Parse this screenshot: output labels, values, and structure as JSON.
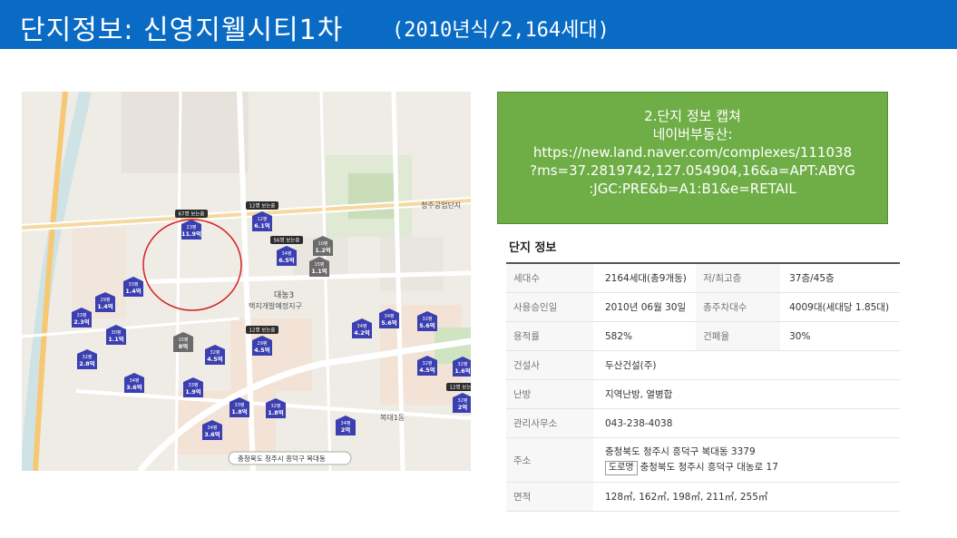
{
  "header": {
    "title_main": "단지정보: 신영지웰시티1차",
    "title_sub": "(2010년식/2,164세대)"
  },
  "colors": {
    "header_bg": "#0a6bc4",
    "capture_bg": "#6fae47",
    "marker_blue": "#3b3fb0",
    "marker_gray": "#6b6b6b",
    "highlight_circle": "#d81f26"
  },
  "capture_note": {
    "lines": [
      "2.단지 정보 캡쳐",
      "네이버부동산:",
      "https://new.land.naver.com/complexes/111038",
      "?ms=37.2819742,127.054904,16&a=APT:ABYG",
      ":JGC:PRE&b=A1:B1&e=RETAIL"
    ]
  },
  "info": {
    "heading": "단지 정보",
    "rows": [
      {
        "label": "세대수",
        "value": "2164세대(총9개동)",
        "label2": "저/최고층",
        "value2": "37층/45층"
      },
      {
        "label": "사용승인일",
        "value": "2010년 06월 30일",
        "label2": "총주차대수",
        "value2": "4009대(세대당 1.85대)"
      },
      {
        "label": "용적률",
        "value": "582%",
        "label2": "건폐율",
        "value2": "30%"
      },
      {
        "label": "건설사",
        "value": "두산건설(주)"
      },
      {
        "label": "난방",
        "value": "지역난방, 열병합"
      },
      {
        "label": "관리사무소",
        "value": "043-238-4038"
      },
      {
        "label": "주소",
        "value": "충청북도 청주시 흥덕구 복대동 3379",
        "road_tag": "도로명",
        "road_value": "충청북도 청주시 흥덕구 대농로 17"
      },
      {
        "label": "면적",
        "value": "128㎡, 162㎡, 198㎡, 211㎡, 255㎡"
      }
    ]
  },
  "map": {
    "markers": [
      {
        "top": "23평",
        "price": "11.9억",
        "kind": "blue",
        "tag": "67명 보는중"
      },
      {
        "top": "12평",
        "price": "6.1억",
        "kind": "blue",
        "tag": "12명 보는중"
      },
      {
        "top": "34평",
        "price": "6.5억",
        "kind": "blue",
        "tag": "56명 보는중"
      },
      {
        "top": "10평",
        "price": "1.2억",
        "kind": "gray"
      },
      {
        "top": "15평",
        "price": "1.1억",
        "kind": "gray"
      },
      {
        "top": "33평",
        "price": "1.4억",
        "kind": "blue"
      },
      {
        "top": "29평",
        "price": "1.4억",
        "kind": "blue"
      },
      {
        "top": "33평",
        "price": "2.3억",
        "kind": "blue"
      },
      {
        "top": "30평",
        "price": "1.1억",
        "kind": "blue"
      },
      {
        "top": "32평",
        "price": "2.8억",
        "kind": "blue"
      },
      {
        "top": "15평",
        "price": "8억",
        "kind": "gray"
      },
      {
        "top": "32평",
        "price": "4.5억",
        "kind": "blue"
      },
      {
        "top": "29평",
        "price": "4.5억",
        "kind": "blue",
        "tag": "12명 보는중"
      },
      {
        "top": "34평",
        "price": "3.6억",
        "kind": "blue"
      },
      {
        "top": "33평",
        "price": "1.9억",
        "kind": "blue"
      },
      {
        "top": "33평",
        "price": "1.8억",
        "kind": "blue"
      },
      {
        "top": "32평",
        "price": "1.8억",
        "kind": "blue"
      },
      {
        "top": "34평",
        "price": "3.6억",
        "kind": "blue"
      },
      {
        "top": "34평",
        "price": "2억",
        "kind": "blue"
      },
      {
        "top": "34평",
        "price": "4.2억",
        "kind": "blue"
      },
      {
        "top": "34평",
        "price": "5.6억",
        "kind": "blue"
      },
      {
        "top": "32평",
        "price": "5.6억",
        "kind": "blue"
      },
      {
        "top": "32평",
        "price": "4.5억",
        "kind": "blue"
      },
      {
        "top": "32평",
        "price": "1.6억",
        "kind": "blue"
      },
      {
        "top": "32평",
        "price": "2억",
        "kind": "blue",
        "tag": "12명 보는중"
      }
    ],
    "labels": {
      "district": "대농3",
      "district_sub": "택지개발예정지구",
      "bokdae": "복대1동",
      "bottom_addr": "충청북도 청주시 흥덕구 복대동",
      "park": "청주공업단지"
    }
  }
}
